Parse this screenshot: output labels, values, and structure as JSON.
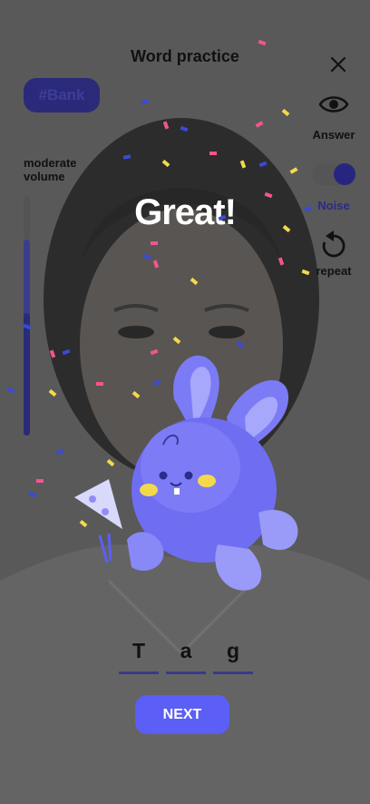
{
  "header": {
    "title": "Word practice",
    "close_icon": "close-icon"
  },
  "tag": {
    "label": "#Bank"
  },
  "side": {
    "answer_label": "Answer",
    "noise_label": "Noise",
    "repeat_label": "repeat",
    "noise_on": true
  },
  "volume": {
    "label_line1": "moderate",
    "label_line2": "volume",
    "level": 0.51
  },
  "result": {
    "message": "Great!"
  },
  "word": {
    "letters": [
      "T",
      "a",
      "g"
    ]
  },
  "actions": {
    "next_label": "NEXT"
  },
  "colors": {
    "accent": "#5b5ff5",
    "bunny": "#6f6ef2",
    "confetti_pink": "#f35590",
    "confetti_yellow": "#f3d94a",
    "confetti_blue": "#3a4bd6"
  }
}
